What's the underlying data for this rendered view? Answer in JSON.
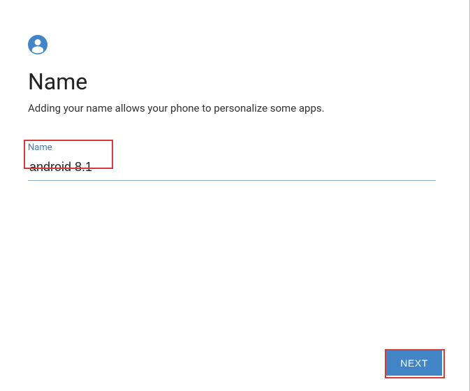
{
  "header": {
    "title": "Name",
    "subtitle": "Adding your name allows your phone to personalize some apps."
  },
  "form": {
    "name_label": "Name",
    "name_value": "android 8.1"
  },
  "actions": {
    "next_label": "NEXT"
  },
  "colors": {
    "accent": "#4285c7",
    "highlight": "#d23c3c"
  }
}
